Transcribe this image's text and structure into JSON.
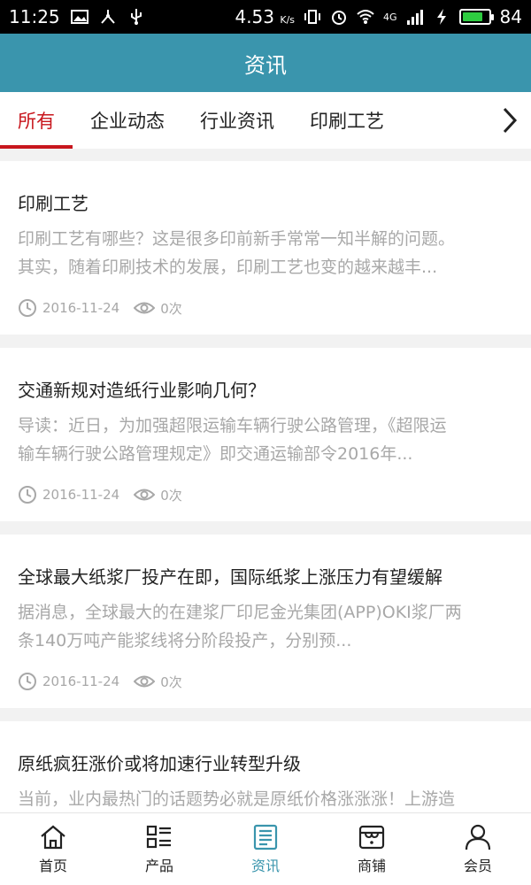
{
  "status_bar": {
    "time": "11:25",
    "speed": "4.53",
    "speed_unit": "K/s",
    "network": "4G",
    "battery": "84",
    "battery_level": 0.84
  },
  "header": {
    "title": "资讯"
  },
  "tabs": [
    {
      "label": "所有",
      "active": true
    },
    {
      "label": "企业动态",
      "active": false
    },
    {
      "label": "行业资讯",
      "active": false
    },
    {
      "label": "印刷工艺",
      "active": false
    }
  ],
  "articles": [
    {
      "title": "印刷工艺",
      "summary_1": "印刷工艺有哪些？这是很多印前新手常常一知半解的问题。",
      "summary_2": "其实，随着印刷技术的发展，印刷工艺也变的越来越丰...",
      "date": "2016-11-24",
      "views": "0次"
    },
    {
      "title": "交通新规对造纸行业影响几何？",
      "summary_1": "导读：近日，为加强超限运输车辆行驶公路管理，《超限运",
      "summary_2": "输车辆行驶公路管理规定》即交通运输部令2016年...",
      "date": "2016-11-24",
      "views": "0次"
    },
    {
      "title": "全球最大纸浆厂投产在即，国际纸浆上涨压力有望缓解",
      "summary_1": "据消息，全球最大的在建浆厂印尼金光集团(APP)OKI浆厂两",
      "summary_2": "条140万吨产能浆线将分阶段投产，分别预...",
      "date": "2016-11-24",
      "views": "0次"
    },
    {
      "title": "原纸疯狂涨价或将加速行业转型升级",
      "summary_1": "当前，业内最热门的话题势必就是原纸价格涨涨涨！上游造",
      "summary_2": "",
      "date": "",
      "views": ""
    }
  ],
  "bottom_nav": [
    {
      "label": "首页",
      "icon": "home-icon",
      "active": false
    },
    {
      "label": "产品",
      "icon": "list-icon",
      "active": false
    },
    {
      "label": "资讯",
      "icon": "news-icon",
      "active": true
    },
    {
      "label": "商铺",
      "icon": "shop-icon",
      "active": false
    },
    {
      "label": "会员",
      "icon": "user-icon",
      "active": false
    }
  ],
  "colors": {
    "primary": "#3a95ad",
    "accent": "#c8161d",
    "muted": "#a8a8a8"
  }
}
